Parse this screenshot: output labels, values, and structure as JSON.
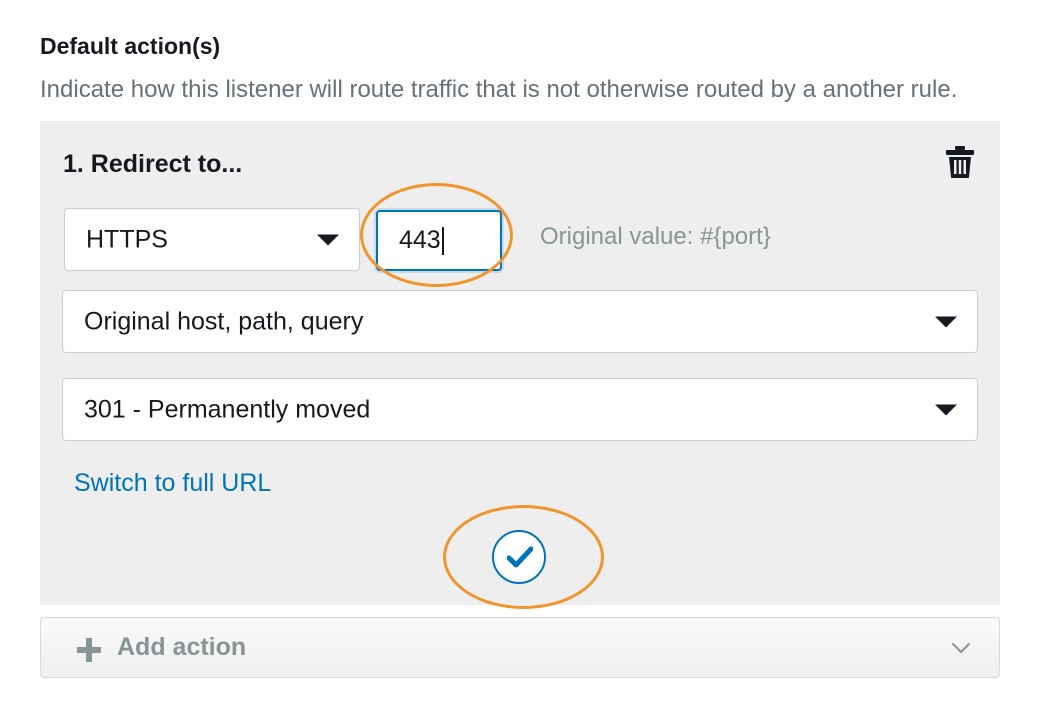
{
  "header": {
    "title": "Default action(s)",
    "description": "Indicate how this listener will route traffic that is not otherwise routed by a another rule."
  },
  "action": {
    "title": "1. Redirect to...",
    "protocol": "HTTPS",
    "port_value": "443",
    "port_hint": "Original value: #{port}",
    "host_path_query": "Original host, path, query",
    "status_code": "301 - Permanently moved",
    "switch_link": "Switch to full URL"
  },
  "footer": {
    "add_action_label": "Add action"
  },
  "colors": {
    "accent": "#0073bb",
    "highlight": "#f0942b",
    "panel_bg": "#eeeeee",
    "muted_text": "#879596"
  },
  "icons": {
    "delete": "trash-icon",
    "confirm": "checkmark-icon",
    "add": "plus-icon",
    "expand": "chevron-down-icon",
    "select_caret": "caret-down-icon"
  }
}
